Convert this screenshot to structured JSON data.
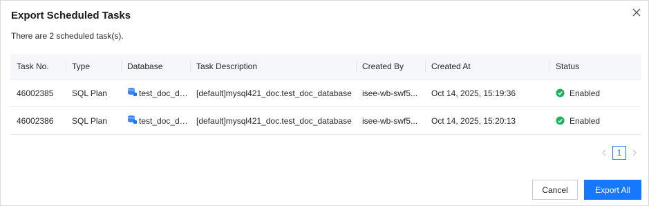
{
  "dialog": {
    "title": "Export Scheduled Tasks",
    "summary": "There are 2 scheduled task(s)."
  },
  "table": {
    "headers": [
      "Task No.",
      "Type",
      "Database",
      "Task Description",
      "Created By",
      "Created At",
      "Status"
    ],
    "rows": [
      {
        "task_no": "46002385",
        "type": "SQL Plan",
        "database": "test_doc_dat...",
        "description": "[default]mysql421_doc.test_doc_database",
        "created_by": "isee-wb-swf5...",
        "created_at": "Oct 14, 2025, 15:19:36",
        "status": "Enabled"
      },
      {
        "task_no": "46002386",
        "type": "SQL Plan",
        "database": "test_doc_dat...",
        "description": "[default]mysql421_doc.test_doc_database",
        "created_by": "isee-wb-swf5...",
        "created_at": "Oct 14, 2025, 15:20:13",
        "status": "Enabled"
      }
    ]
  },
  "pagination": {
    "current_page": "1"
  },
  "buttons": {
    "cancel": "Cancel",
    "export_all": "Export All"
  },
  "colors": {
    "primary": "#1677ff",
    "enabled": "#1bb35a",
    "header_bg": "#f5f7fa"
  },
  "icons": {
    "close": "close-icon",
    "database": "database-icon",
    "status": "check-circle-icon",
    "prev": "chevron-left-icon",
    "next": "chevron-right-icon"
  }
}
